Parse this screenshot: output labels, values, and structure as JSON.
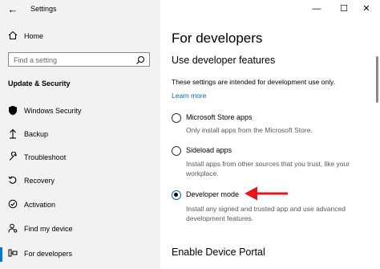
{
  "window": {
    "title": "Settings",
    "controls": {
      "minimize": "—",
      "maximize": "☐",
      "close": "✕"
    }
  },
  "sidebar": {
    "back_glyph": "←",
    "home_label": "Home",
    "search_placeholder": "Find a setting",
    "section_label": "Update & Security",
    "items": [
      {
        "label": "Windows Security",
        "icon": "shield-icon",
        "glyph": "⛨"
      },
      {
        "label": "Backup",
        "icon": "backup-icon",
        "glyph": "⤒"
      },
      {
        "label": "Troubleshoot",
        "icon": "wrench-icon",
        "glyph": "🔧"
      },
      {
        "label": "Recovery",
        "icon": "recovery-icon",
        "glyph": "⟲"
      },
      {
        "label": "Activation",
        "icon": "activation-icon",
        "glyph": "✓"
      },
      {
        "label": "Find my device",
        "icon": "person-location-icon",
        "glyph": "⚲"
      },
      {
        "label": "For developers",
        "icon": "developer-icon",
        "glyph": "⚙",
        "active": true
      }
    ],
    "accent_color": "#0078d4"
  },
  "main": {
    "title": "For developers",
    "subtitle": "Use developer features",
    "description": "These settings are intended for development use only.",
    "learn_more": "Learn more",
    "options": [
      {
        "title": "Microsoft Store apps",
        "desc": "Only install apps from the Microsoft Store.",
        "checked": false
      },
      {
        "title": "Sideload apps",
        "desc": "Install apps from other sources that you trust, like your workplace.",
        "checked": false
      },
      {
        "title": "Developer mode",
        "desc": "Install any signed and trusted app and use advanced development features.",
        "checked": true
      }
    ],
    "section2_title": "Enable Device Portal",
    "annotation_arrow_color": "#e8141b"
  }
}
